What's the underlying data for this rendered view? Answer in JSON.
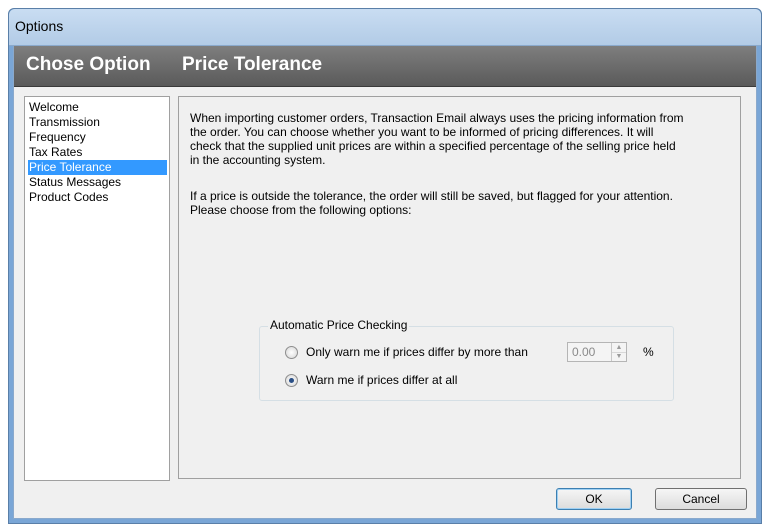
{
  "window": {
    "title": "Options"
  },
  "header": {
    "left": "Chose Option",
    "right": "Price Tolerance"
  },
  "sidebar": {
    "items": [
      {
        "label": "Welcome",
        "selected": false
      },
      {
        "label": "Transmission",
        "selected": false
      },
      {
        "label": "Frequency",
        "selected": false
      },
      {
        "label": "Tax Rates",
        "selected": false
      },
      {
        "label": "Price Tolerance",
        "selected": true
      },
      {
        "label": "Status Messages",
        "selected": false
      },
      {
        "label": "Product Codes",
        "selected": false
      }
    ]
  },
  "content": {
    "para1_line1": "When importing customer orders, Transaction Email always uses the pricing information from",
    "para1_line2": "the order. You can choose whether you want to be informed of pricing differences. It will",
    "para1_line3": "check that the supplied unit prices are within a specified percentage of the selling price held",
    "para1_line4": "in the accounting system.",
    "para2_line1": "If a price is outside the tolerance, the order will still be saved, but flagged for your attention.",
    "para2_line2": "Please choose from the following options:",
    "group": {
      "title": "Automatic Price Checking",
      "option1_label": "Only warn me if prices differ by more than",
      "option1_value": "0.00",
      "option1_unit": "%",
      "option2_label": "Warn me if prices differ at all",
      "selected_option": 2
    }
  },
  "buttons": {
    "ok": "OK",
    "cancel": "Cancel"
  }
}
